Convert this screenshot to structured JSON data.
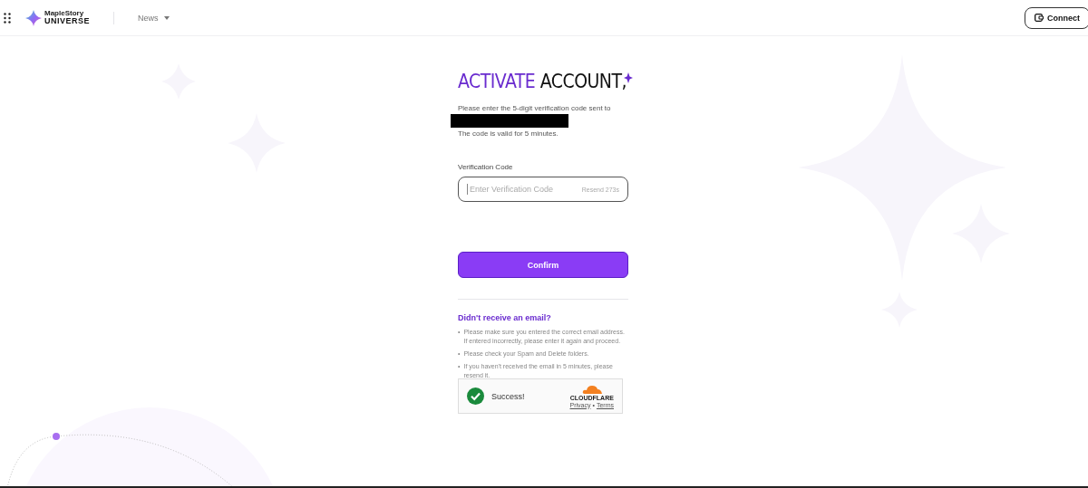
{
  "header": {
    "logo": {
      "line_1": "MapleStory",
      "line_2": "UNIVERSE"
    },
    "nav": [
      {
        "label": "News",
        "has_menu": true
      }
    ],
    "connect_button": "Connect"
  },
  "form": {
    "title_accent": "ACTIVATE",
    "title_rest": "ACCOUNT,",
    "intro": "Please enter the 5-digit verification code sent to",
    "validity": "The code is valid for 5 minutes.",
    "field_label": "Verification Code",
    "field": {
      "placeholder": "Enter Verification Code",
      "resend": "Resend 273s"
    },
    "confirm_button": "Confirm"
  },
  "help": {
    "title": "Didn't receive an email?",
    "items": [
      {
        "bullet": "•",
        "text": "Please make sure you entered the correct email address. If entered incorrectly, please enter it again and proceed."
      },
      {
        "bullet": "•",
        "text": "Please check your Spam and Delete folders."
      },
      {
        "bullet": "•",
        "text": "If you haven't received the email in 5 minutes, please resend it."
      }
    ]
  },
  "captcha": {
    "status": "Success!",
    "success": true,
    "brand": "CLOUDFLARE",
    "privacy": "Privacy",
    "separator": "•",
    "terms": "Terms"
  }
}
